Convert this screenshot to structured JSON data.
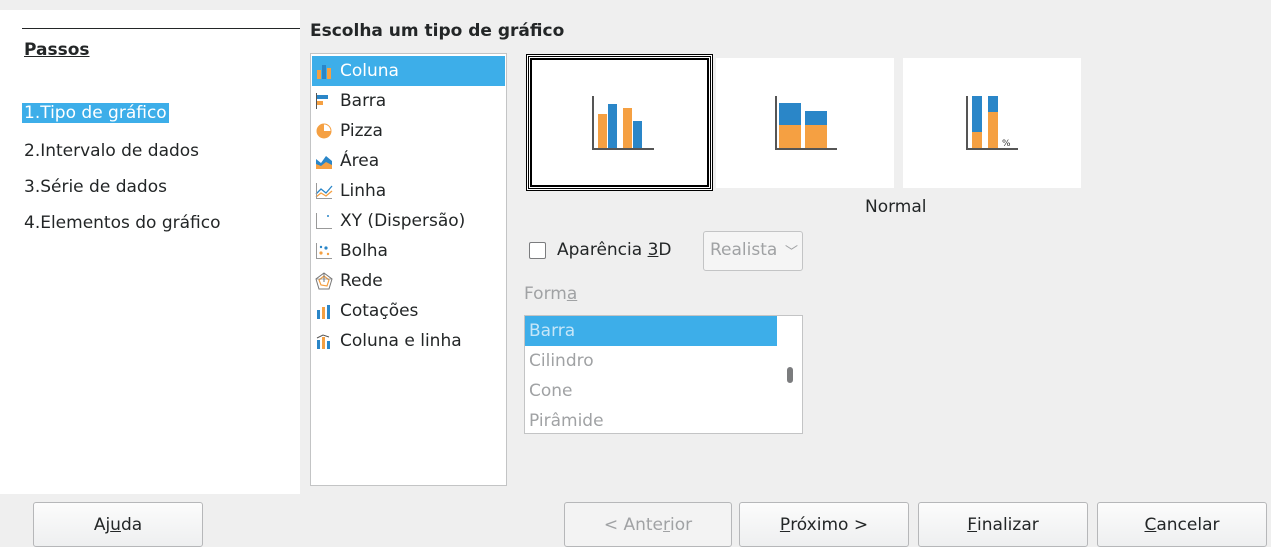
{
  "steps": {
    "title": "Passos",
    "items": [
      {
        "label": "1.Tipo de gráfico",
        "selected": true
      },
      {
        "label": "2.Intervalo de dados"
      },
      {
        "label": "3.Série de dados"
      },
      {
        "label": "4.Elementos do gráfico"
      }
    ]
  },
  "main": {
    "title": "Escolha um tipo de gráfico",
    "chart_types": [
      {
        "label": "Coluna",
        "icon": "column-chart-icon",
        "selected": true
      },
      {
        "label": "Barra",
        "icon": "bar-chart-icon"
      },
      {
        "label": "Pizza",
        "icon": "pie-chart-icon"
      },
      {
        "label": "Área",
        "icon": "area-chart-icon"
      },
      {
        "label": "Linha",
        "icon": "line-chart-icon"
      },
      {
        "label": "XY (Dispersão)",
        "icon": "scatter-chart-icon"
      },
      {
        "label": "Bolha",
        "icon": "bubble-chart-icon"
      },
      {
        "label": "Rede",
        "icon": "net-chart-icon"
      },
      {
        "label": "Cotações",
        "icon": "stock-chart-icon"
      },
      {
        "label": "Coluna e linha",
        "icon": "column-line-chart-icon"
      }
    ],
    "variants": {
      "selected_caption": "Normal",
      "percent_mark": "%"
    },
    "appearance_3d": {
      "label_pre": "Aparência ",
      "label_mnemonic": "3",
      "label_post": "D",
      "checked": false,
      "combo_value": "Realista"
    },
    "shape": {
      "label_pre": "Form",
      "label_mnemonic": "a",
      "items": [
        {
          "label": "Barra",
          "selected": true
        },
        {
          "label": "Cilindro"
        },
        {
          "label": "Cone"
        },
        {
          "label": "Pirâmide"
        }
      ]
    }
  },
  "buttons": {
    "help": {
      "pre": "Aj",
      "mn": "u",
      "post": "da"
    },
    "back": {
      "pre": "< Ante",
      "mn": "r",
      "post": "ior"
    },
    "next": {
      "pre": "",
      "mn": "P",
      "post": "róximo >"
    },
    "finish": {
      "pre": "",
      "mn": "F",
      "post": "inalizar"
    },
    "cancel": {
      "pre": "",
      "mn": "C",
      "post": "ancelar"
    }
  },
  "colors": {
    "accent": "#3daee9",
    "orange": "#f5a042",
    "blue": "#2a86c8"
  }
}
